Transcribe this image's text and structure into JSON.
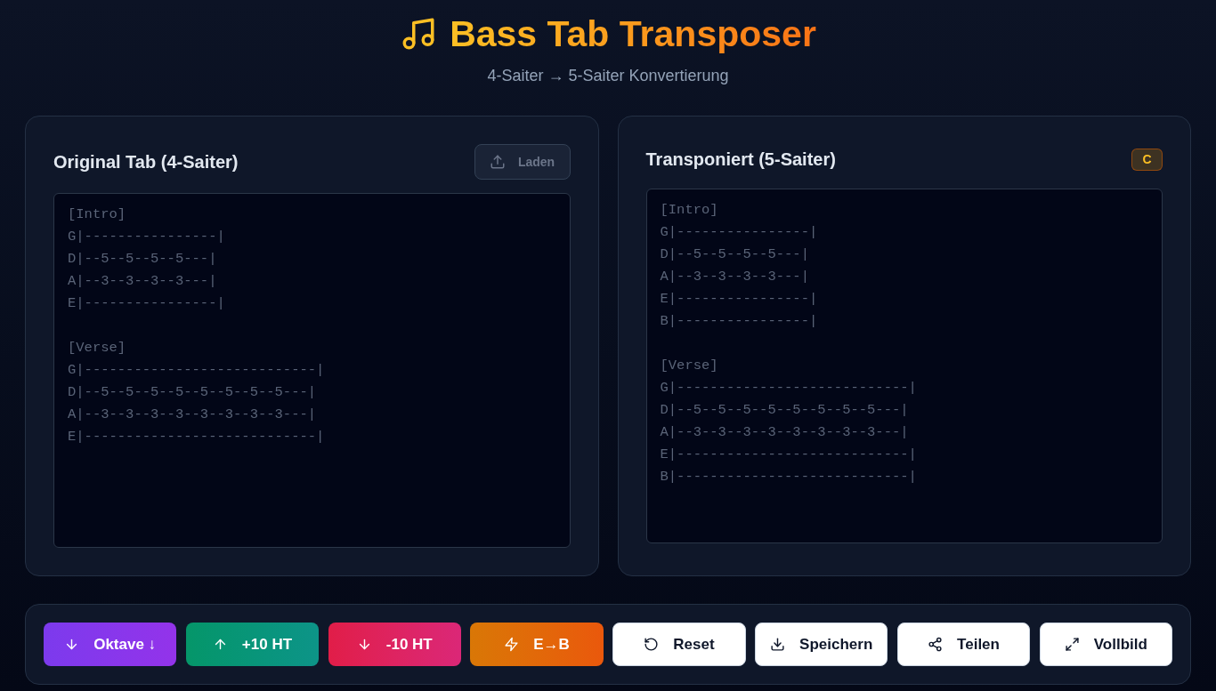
{
  "header": {
    "title": "Bass Tab Transposer",
    "subtitle": "4-Saiter → 5-Saiter Konvertierung"
  },
  "panels": [
    {
      "title": "Original Tab (4-Saiter)",
      "button": {
        "label": "Laden",
        "disabled": true
      },
      "sections": [
        {
          "label": "[Intro]",
          "lines": [
            "G|----------------|",
            "D|--5--5--5--5---|",
            "A|--3--3--3--3---|",
            "E|----------------|"
          ]
        },
        {
          "label": "[Verse]",
          "lines": [
            "G|----------------------------|",
            "D|--5--5--5--5--5--5--5--5---|",
            "A|--3--3--3--3--3--3--3--3---|",
            "E|----------------------------|"
          ]
        }
      ]
    },
    {
      "title": "Transponiert (5-Saiter)",
      "badge": "C",
      "sections": [
        {
          "label": "[Intro]",
          "lines": [
            "G|----------------|",
            "D|--5--5--5--5---|",
            "A|--3--3--3--3---|",
            "E|----------------|",
            "B|----------------|"
          ]
        },
        {
          "label": "[Verse]",
          "lines": [
            "G|----------------------------|",
            "D|--5--5--5--5--5--5--5--5---|",
            "A|--3--3--3--3--3--3--3--3---|",
            "E|----------------------------|",
            "B|----------------------------|"
          ]
        }
      ]
    }
  ],
  "toolbar": [
    {
      "kind": "octave",
      "label": "Oktave ↓"
    },
    {
      "kind": "up",
      "label": "+10 HT"
    },
    {
      "kind": "down",
      "label": "-10 HT"
    },
    {
      "kind": "convert",
      "label": "E→B"
    },
    {
      "kind": "reset",
      "label": "Reset"
    },
    {
      "kind": "save",
      "label": "Speichern"
    },
    {
      "kind": "share",
      "label": "Teilen"
    },
    {
      "kind": "fullscreen",
      "label": "Vollbild"
    }
  ]
}
